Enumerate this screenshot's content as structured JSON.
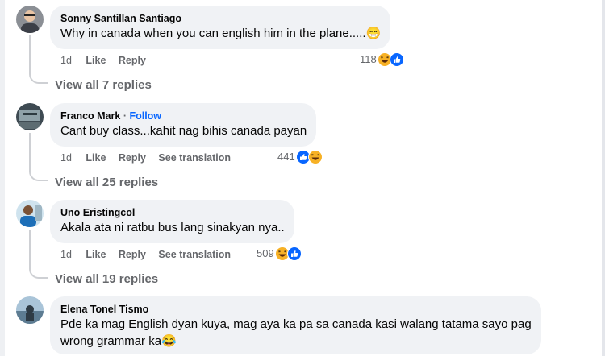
{
  "comments": [
    {
      "author": "Sonny Santillan Santiago",
      "text": "Why in canada when you can english him in the plane.....",
      "emoji": "😁",
      "time": "1d",
      "like": "Like",
      "reply": "Reply",
      "reaction_count": "118",
      "reactions": [
        "haha",
        "like"
      ],
      "view_replies": "View all 7 replies"
    },
    {
      "author": "Franco Mark",
      "follow": "Follow",
      "text": "Cant buy class...kahit nag bihis canada payan",
      "time": "1d",
      "like": "Like",
      "reply": "Reply",
      "see_translation": "See translation",
      "reaction_count": "441",
      "reactions": [
        "like",
        "haha"
      ],
      "view_replies": "View all 25 replies"
    },
    {
      "author": "Uno Eristingcol",
      "text": "Akala ata ni ratbu bus lang sinakyan nya..",
      "time": "1d",
      "like": "Like",
      "reply": "Reply",
      "see_translation": "See translation",
      "reaction_count": "509",
      "reactions": [
        "haha",
        "like"
      ],
      "view_replies": "View all 19 replies"
    },
    {
      "author": "Elena Tonel Tismo",
      "text_line1": "Pde ka mag English dyan kuya, mag aya ka pa sa canada kasi walang tatama sayo pag",
      "text_line2": "wrong grammar ka",
      "emoji": "😂"
    }
  ],
  "colors": {
    "bubble": "#f0f2f5",
    "secondary_text": "#65676b",
    "link_blue": "#0866ff",
    "like_blue": "#0866ff",
    "haha_yellow": "#f7b125"
  }
}
